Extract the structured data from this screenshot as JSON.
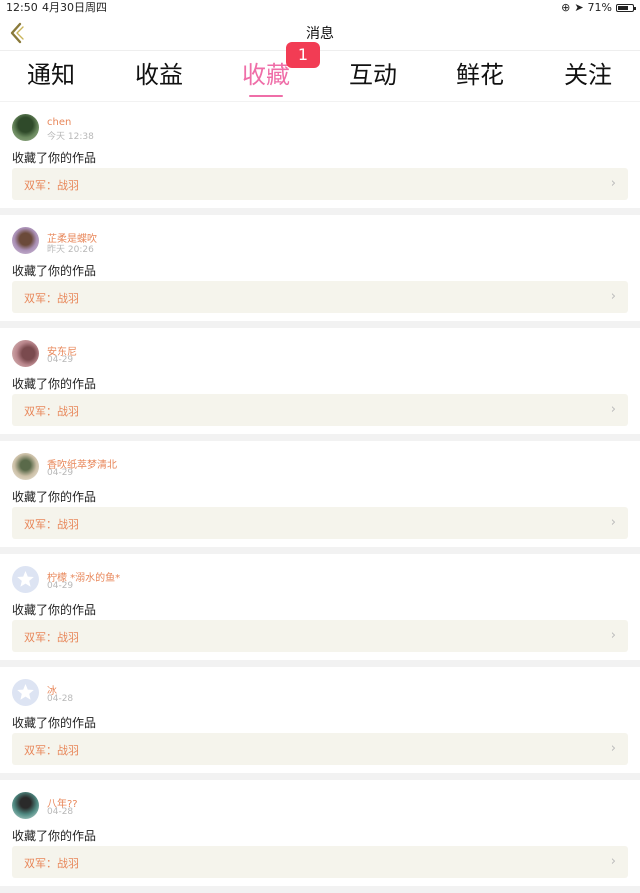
{
  "status_bar": {
    "time": "12:50",
    "date": "4月30日周四",
    "battery_text": "71%"
  },
  "nav": {
    "title": "消息"
  },
  "tabs": [
    {
      "label": "通知",
      "active": false
    },
    {
      "label": "收益",
      "active": false
    },
    {
      "label": "收藏",
      "active": true
    },
    {
      "label": "互动",
      "active": false
    },
    {
      "label": "鲜花",
      "active": false
    },
    {
      "label": "关注",
      "active": false
    }
  ],
  "badge": {
    "count": "1"
  },
  "items": [
    {
      "user": "chen",
      "time": "今天 12:38",
      "action": "收藏了你的作品",
      "work": "双军：战羽",
      "avatar": "photo",
      "avatar_color": "#6b8a5f"
    },
    {
      "user": "芷柔是蝶吹",
      "time": "昨天 20:26",
      "action": "收藏了你的作品",
      "work": "双军：战羽",
      "avatar": "photo",
      "avatar_color": "#a98fb5"
    },
    {
      "user": "安东尼",
      "time": "04-29",
      "action": "收藏了你的作品",
      "work": "双军：战羽",
      "avatar": "photo",
      "avatar_color": "#b9868c"
    },
    {
      "user": "香吹纸萃梦清北",
      "time": "04-29",
      "action": "收藏了你的作品",
      "work": "双军：战羽",
      "avatar": "photo",
      "avatar_color": "#cbbfa6"
    },
    {
      "user": "柠檬 *溺水的鱼*",
      "time": "04-29",
      "action": "收藏了你的作品",
      "work": "双军：战羽",
      "avatar": "default",
      "avatar_color": "#dde4f3"
    },
    {
      "user": "冰",
      "time": "04-28",
      "action": "收藏了你的作品",
      "work": "双军：战羽",
      "avatar": "default",
      "avatar_color": "#dde4f3"
    },
    {
      "user": "八年??",
      "time": "04-28",
      "action": "收藏了你的作品",
      "work": "双军：战羽",
      "avatar": "photo",
      "avatar_color": "#4f8a82"
    }
  ],
  "colors": {
    "accent": "#ef6ea8",
    "badge": "#f23c54",
    "username": "#e8875a",
    "work_bg": "#f5f4ec"
  }
}
